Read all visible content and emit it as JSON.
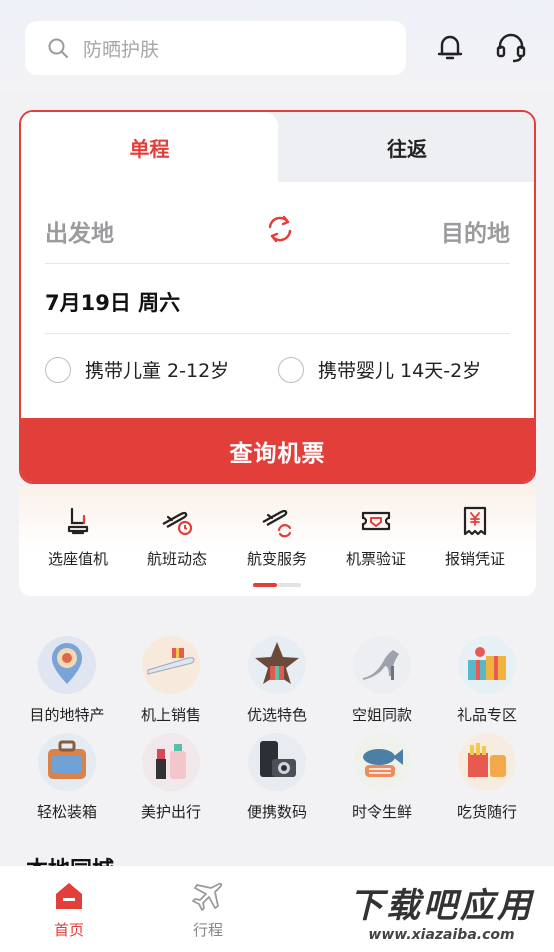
{
  "search": {
    "placeholder": "防晒护肤"
  },
  "header_icons": [
    "bell-icon",
    "headset-icon"
  ],
  "booking": {
    "tabs": [
      {
        "label": "单程",
        "active": true
      },
      {
        "label": "往返",
        "active": false
      }
    ],
    "from": "出发地",
    "to": "目的地",
    "date": "7月19日 周六",
    "options": [
      {
        "label": "携带儿童 2-12岁",
        "checked": false
      },
      {
        "label": "携带婴儿 14天-2岁",
        "checked": false
      }
    ],
    "search_button": "查询机票"
  },
  "services": [
    {
      "label": "选座值机",
      "icon": "seat-icon"
    },
    {
      "label": "航班动态",
      "icon": "flight-clock-icon"
    },
    {
      "label": "航变服务",
      "icon": "flight-change-icon"
    },
    {
      "label": "机票验证",
      "icon": "ticket-verify-icon"
    },
    {
      "label": "报销凭证",
      "icon": "receipt-icon"
    }
  ],
  "shop": [
    {
      "label": "目的地特产",
      "icon": "location-pin-image"
    },
    {
      "label": "机上销售",
      "icon": "airplane-gift-image"
    },
    {
      "label": "优选特色",
      "icon": "star-gift-image"
    },
    {
      "label": "空姐同款",
      "icon": "high-heel-image"
    },
    {
      "label": "礼品专区",
      "icon": "gift-box-image"
    },
    {
      "label": "轻松装箱",
      "icon": "suitcase-image"
    },
    {
      "label": "美护出行",
      "icon": "cosmetics-image"
    },
    {
      "label": "便携数码",
      "icon": "camera-phone-image"
    },
    {
      "label": "时令生鲜",
      "icon": "fresh-fish-image"
    },
    {
      "label": "吃货随行",
      "icon": "snacks-image"
    }
  ],
  "section_title": "本地同城",
  "tabbar": [
    {
      "label": "首页",
      "active": true
    },
    {
      "label": "行程",
      "active": false
    }
  ],
  "watermark": {
    "text": "下载吧应用",
    "url": "www.xiazaiba.com"
  },
  "colors": {
    "accent": "#e23e3a",
    "background": "#f2f2f4"
  }
}
